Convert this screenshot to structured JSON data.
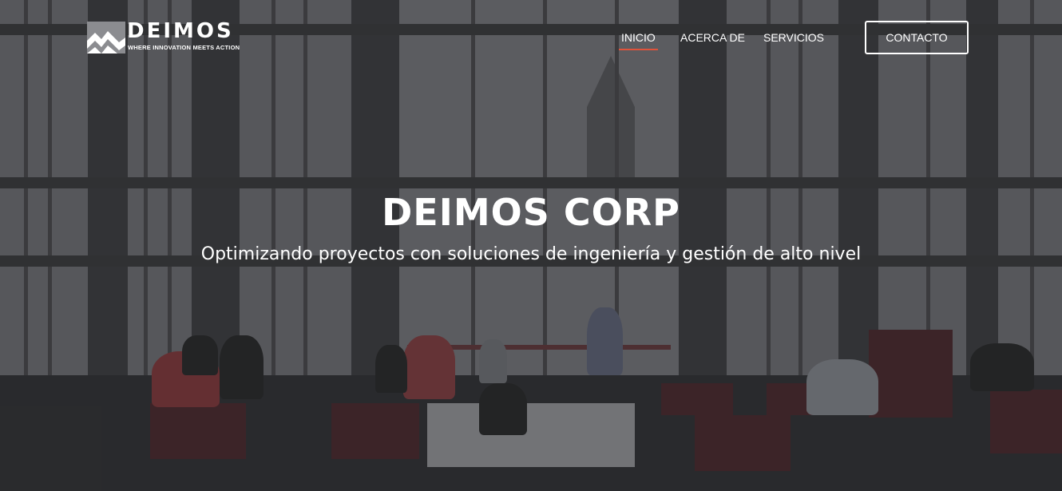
{
  "brand": {
    "name": "DEIMOS",
    "tagline": "WHERE INNOVATION MEETS ACTION",
    "accent_color": "#e0533b"
  },
  "nav": {
    "items": [
      {
        "label": "INICIO",
        "active": true
      },
      {
        "label": "ACERCA DE",
        "active": false
      },
      {
        "label": "SERVICIOS",
        "active": false
      }
    ],
    "contact_label": "CONTACTO"
  },
  "hero": {
    "title": "DEIMOS CORP",
    "subtitle": "Optimizando proyectos con soluciones de ingeniería y gestión de alto nivel",
    "background": "grayscale-photo-of-office-atrium-with-people-seated"
  }
}
